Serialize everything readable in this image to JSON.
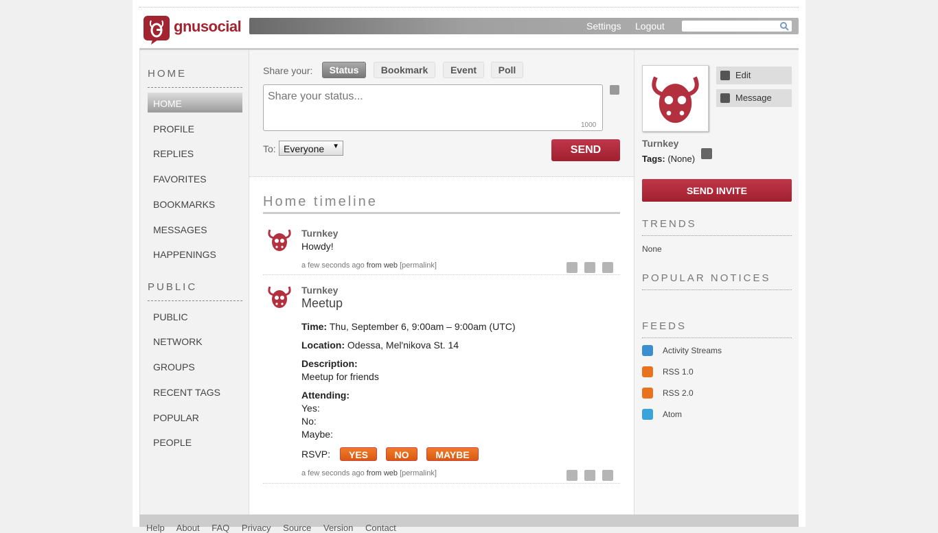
{
  "site": {
    "logo_text": "gnusocial"
  },
  "header": {
    "settings": "Settings",
    "logout": "Logout",
    "search_placeholder": ""
  },
  "left_nav": {
    "home_heading": "HOME",
    "home_items": [
      "HOME",
      "PROFILE",
      "REPLIES",
      "FAVORITES",
      "BOOKMARKS",
      "MESSAGES",
      "HAPPENINGS"
    ],
    "public_heading": "PUBLIC",
    "public_items": [
      "PUBLIC",
      "NETWORK",
      "GROUPS",
      "RECENT TAGS",
      "POPULAR",
      "PEOPLE"
    ]
  },
  "share": {
    "label": "Share your:",
    "tabs": [
      "Status",
      "Bookmark",
      "Event",
      "Poll"
    ],
    "placeholder": "Share your status...",
    "char_count": "1000",
    "to_label": "To:",
    "to_value": "Everyone",
    "send": "SEND"
  },
  "timeline": {
    "title": "Home timeline",
    "notices": [
      {
        "author": "Turnkey",
        "text": "Howdy!",
        "time": "a few seconds ago",
        "from_prefix": "from",
        "from": "web",
        "permalink": "[permalink]"
      },
      {
        "author": "Turnkey",
        "event_title": "Meetup",
        "time_label": "Time:",
        "time_value": "Thu, September 6, 9:00am – 9:00am (UTC)",
        "location_label": "Location:",
        "location_value": "Odessa, Mel'nikova St. 14",
        "description_label": "Description:",
        "description_value": "Meetup for friends",
        "attending_label": "Attending:",
        "yes_label": "Yes:",
        "no_label": "No:",
        "maybe_label": "Maybe:",
        "rsvp_label": "RSVP:",
        "rsvp_yes": "YES",
        "rsvp_no": "NO",
        "rsvp_maybe": "MAYBE",
        "time": "a few seconds ago",
        "from_prefix": "from",
        "from": "web",
        "permalink": "[permalink]"
      }
    ]
  },
  "profile": {
    "edit": "Edit",
    "message": "Message",
    "name": "Turnkey",
    "tags_label": "Tags:",
    "tags_value": "(None)",
    "invite": "SEND INVITE"
  },
  "trends": {
    "heading": "TRENDS",
    "value": "None"
  },
  "popular": {
    "heading": "POPULAR NOTICES"
  },
  "feeds": {
    "heading": "FEEDS",
    "items": [
      "Activity Streams",
      "RSS 1.0",
      "RSS 2.0",
      "Atom"
    ]
  },
  "footer": {
    "links": [
      "Help",
      "About",
      "FAQ",
      "Privacy",
      "Source",
      "Version",
      "Contact"
    ]
  },
  "colors": {
    "brand": "#a22430",
    "rsvp": "#e8691c"
  }
}
